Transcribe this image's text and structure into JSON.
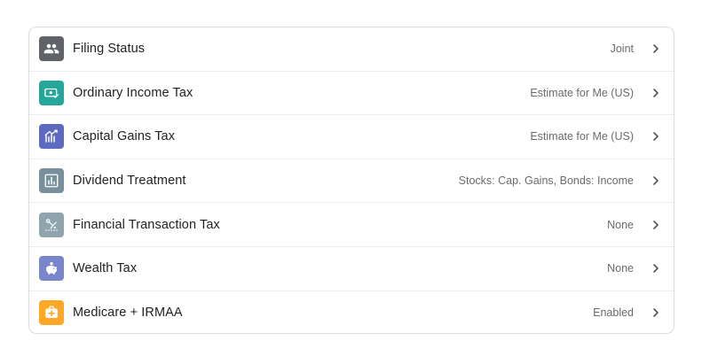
{
  "settings": {
    "rows": [
      {
        "label": "Filing Status",
        "value": "Joint",
        "icon": "people-icon",
        "color": "#5f6368"
      },
      {
        "label": "Ordinary Income Tax",
        "value": "Estimate for Me (US)",
        "icon": "money-check-icon",
        "color": "#26a69a"
      },
      {
        "label": "Capital Gains Tax",
        "value": "Estimate for Me (US)",
        "icon": "trending-chart-icon",
        "color": "#5c6bc0"
      },
      {
        "label": "Dividend Treatment",
        "value": "Stocks: Cap. Gains, Bonds: Income",
        "icon": "bar-chart-icon",
        "color": "#78909c"
      },
      {
        "label": "Financial Transaction Tax",
        "value": "None",
        "icon": "transaction-icon",
        "color": "#90a4ae"
      },
      {
        "label": "Wealth Tax",
        "value": "None",
        "icon": "piggy-bank-icon",
        "color": "#7986cb"
      },
      {
        "label": "Medicare + IRMAA",
        "value": "Enabled",
        "icon": "medical-bag-icon",
        "color": "#ffa726"
      }
    ]
  }
}
